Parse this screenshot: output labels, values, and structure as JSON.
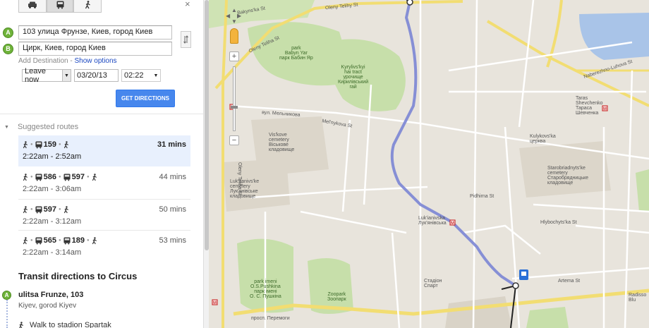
{
  "panel": {
    "close_glyph": "×",
    "modes": [
      "car-icon",
      "bus-icon",
      "walk-icon"
    ],
    "from_marker": "A",
    "from_value": "103 улица Фрунзе, Киев, город Киев",
    "to_marker": "B",
    "to_value": "Цирк, Киев, город Киев",
    "add_destination": "Add Destination",
    "sep": " - ",
    "show_options": "Show options",
    "leave_now": "Leave now",
    "date": "03/20/13",
    "time": "02:22",
    "get_directions": "GET DIRECTIONS",
    "suggested_routes": "Suggested routes",
    "routes": [
      {
        "legs": [
          "159"
        ],
        "duration": "31 mins",
        "times": "2:22am - 2:52am"
      },
      {
        "legs": [
          "586",
          "597"
        ],
        "duration": "44 mins",
        "times": "2:22am - 3:06am"
      },
      {
        "legs": [
          "597"
        ],
        "duration": "50 mins",
        "times": "2:22am - 3:12am"
      },
      {
        "legs": [
          "565",
          "189"
        ],
        "duration": "53 mins",
        "times": "2:22am - 3:14am"
      }
    ],
    "transit_heading": "Transit directions to Circus",
    "step_marker": "A",
    "step_name": "ulitsa Frunze, 103",
    "step_sub": "Kiyev, gorod Kiyev",
    "walk_step": "Walk to stadion Spartak"
  },
  "map": {
    "labels": {
      "bakynska": "Bakyns'ka St",
      "olenyteliha_top": "Oleny Telihy St",
      "olenyteliha_left": "Oleny Teliha St",
      "olenyteliha_vert": "Oleny Teliha St",
      "park_babyn_yar": "park\nBabyn Yar\nпарк Бабин Яр",
      "kyrylivskyi": "Kyrylivs'kyi\nhai tract\nурочище\nКирилівський\nгай",
      "melnykova1": "Mel'nykova St",
      "melnykova2": "вул. Мельникова",
      "vinkove": "Vis'kove\ncemetery\nВіськове\nкладовище",
      "lukianivske": "Luk'yanivs'ke\ncemetery\nЛук'янівське\nкладовище",
      "lukianivska_station": "Luk'ianivska\nЛук'янівська",
      "park_pushkina": "park imeni\nO.S.Pushkina\nпарк імені\nО. С. Пушкіна",
      "zoopark": "Zoopark\nЗоопарк",
      "taras": "Taras\nShevchenko\nТараса\nШевченка",
      "kulykovska": "Kulykovs'ka\nцерква",
      "starobriad": "Starobriadnyts'ke\ncemetery\nСтаробрядницьке\nкладовище",
      "artema": "Artema St",
      "hlybochytska": "Hlybochyts'ka St",
      "pidhirna": "Pidhirna St",
      "stadion_spartak": "Стадіон\nСпарт",
      "naberezhne": "Naberezhno-Luhova St",
      "pryorna": "просп. Перемоги",
      "radisson": "Radisso\nBlu",
      "hlybochytska2": "Hlybochyts'ka"
    }
  }
}
